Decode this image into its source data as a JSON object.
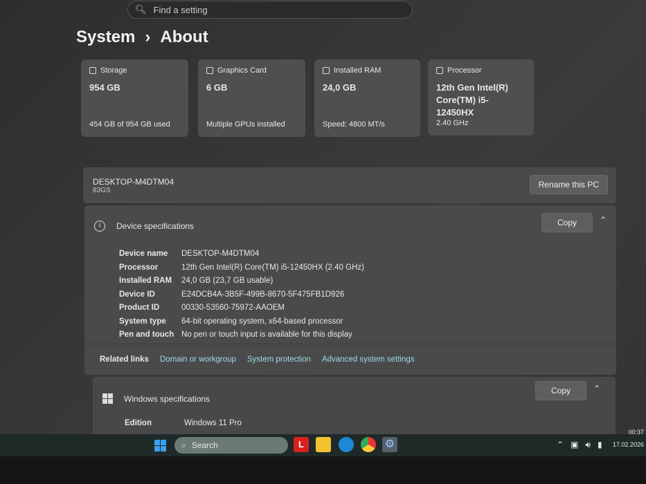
{
  "search": {
    "placeholder": "Find a setting"
  },
  "breadcrumb": {
    "parent": "System",
    "separator": "›",
    "current": "About"
  },
  "cards": [
    {
      "label": "Storage",
      "value": "954 GB",
      "footer": "454 GB of 954 GB used"
    },
    {
      "label": "Graphics Card",
      "value": "6 GB",
      "footer": "Multiple GPUs installed"
    },
    {
      "label": "Installed RAM",
      "value": "24,0 GB",
      "footer": "Speed: 4800 MT/s"
    },
    {
      "label": "Processor",
      "value": "12th Gen Intel(R) Core(TM) i5-12450HX",
      "footer": "2.40 GHz"
    }
  ],
  "pc": {
    "name": "DESKTOP-M4DTM04",
    "model": "83GS",
    "rename_label": "Rename this PC"
  },
  "device_specs": {
    "title": "Device specifications",
    "copy_label": "Copy",
    "rows": [
      {
        "k": "Device name",
        "v": "DESKTOP-M4DTM04"
      },
      {
        "k": "Processor",
        "v": "12th Gen Intel(R) Core(TM) i5-12450HX (2.40 GHz)"
      },
      {
        "k": "Installed RAM",
        "v": "24,0 GB (23,7 GB usable)"
      },
      {
        "k": "Device ID",
        "v": "E24DCB4A-3B5F-499B-8670-5F475FB1D926"
      },
      {
        "k": "Product ID",
        "v": "00330-53560-75972-AAOEM"
      },
      {
        "k": "System type",
        "v": "64-bit operating system, x64-based processor"
      },
      {
        "k": "Pen and touch",
        "v": "No pen or touch input is available for this display"
      }
    ]
  },
  "related": {
    "label": "Related links",
    "links": [
      "Domain or workgroup",
      "System protection",
      "Advanced system settings"
    ]
  },
  "windows_specs": {
    "title": "Windows specifications",
    "copy_label": "Copy",
    "edition_label": "Edition",
    "edition": "Windows 11 Pro"
  },
  "taskbar": {
    "search": "Search",
    "time": "00:37",
    "date": "17.02.2026"
  }
}
